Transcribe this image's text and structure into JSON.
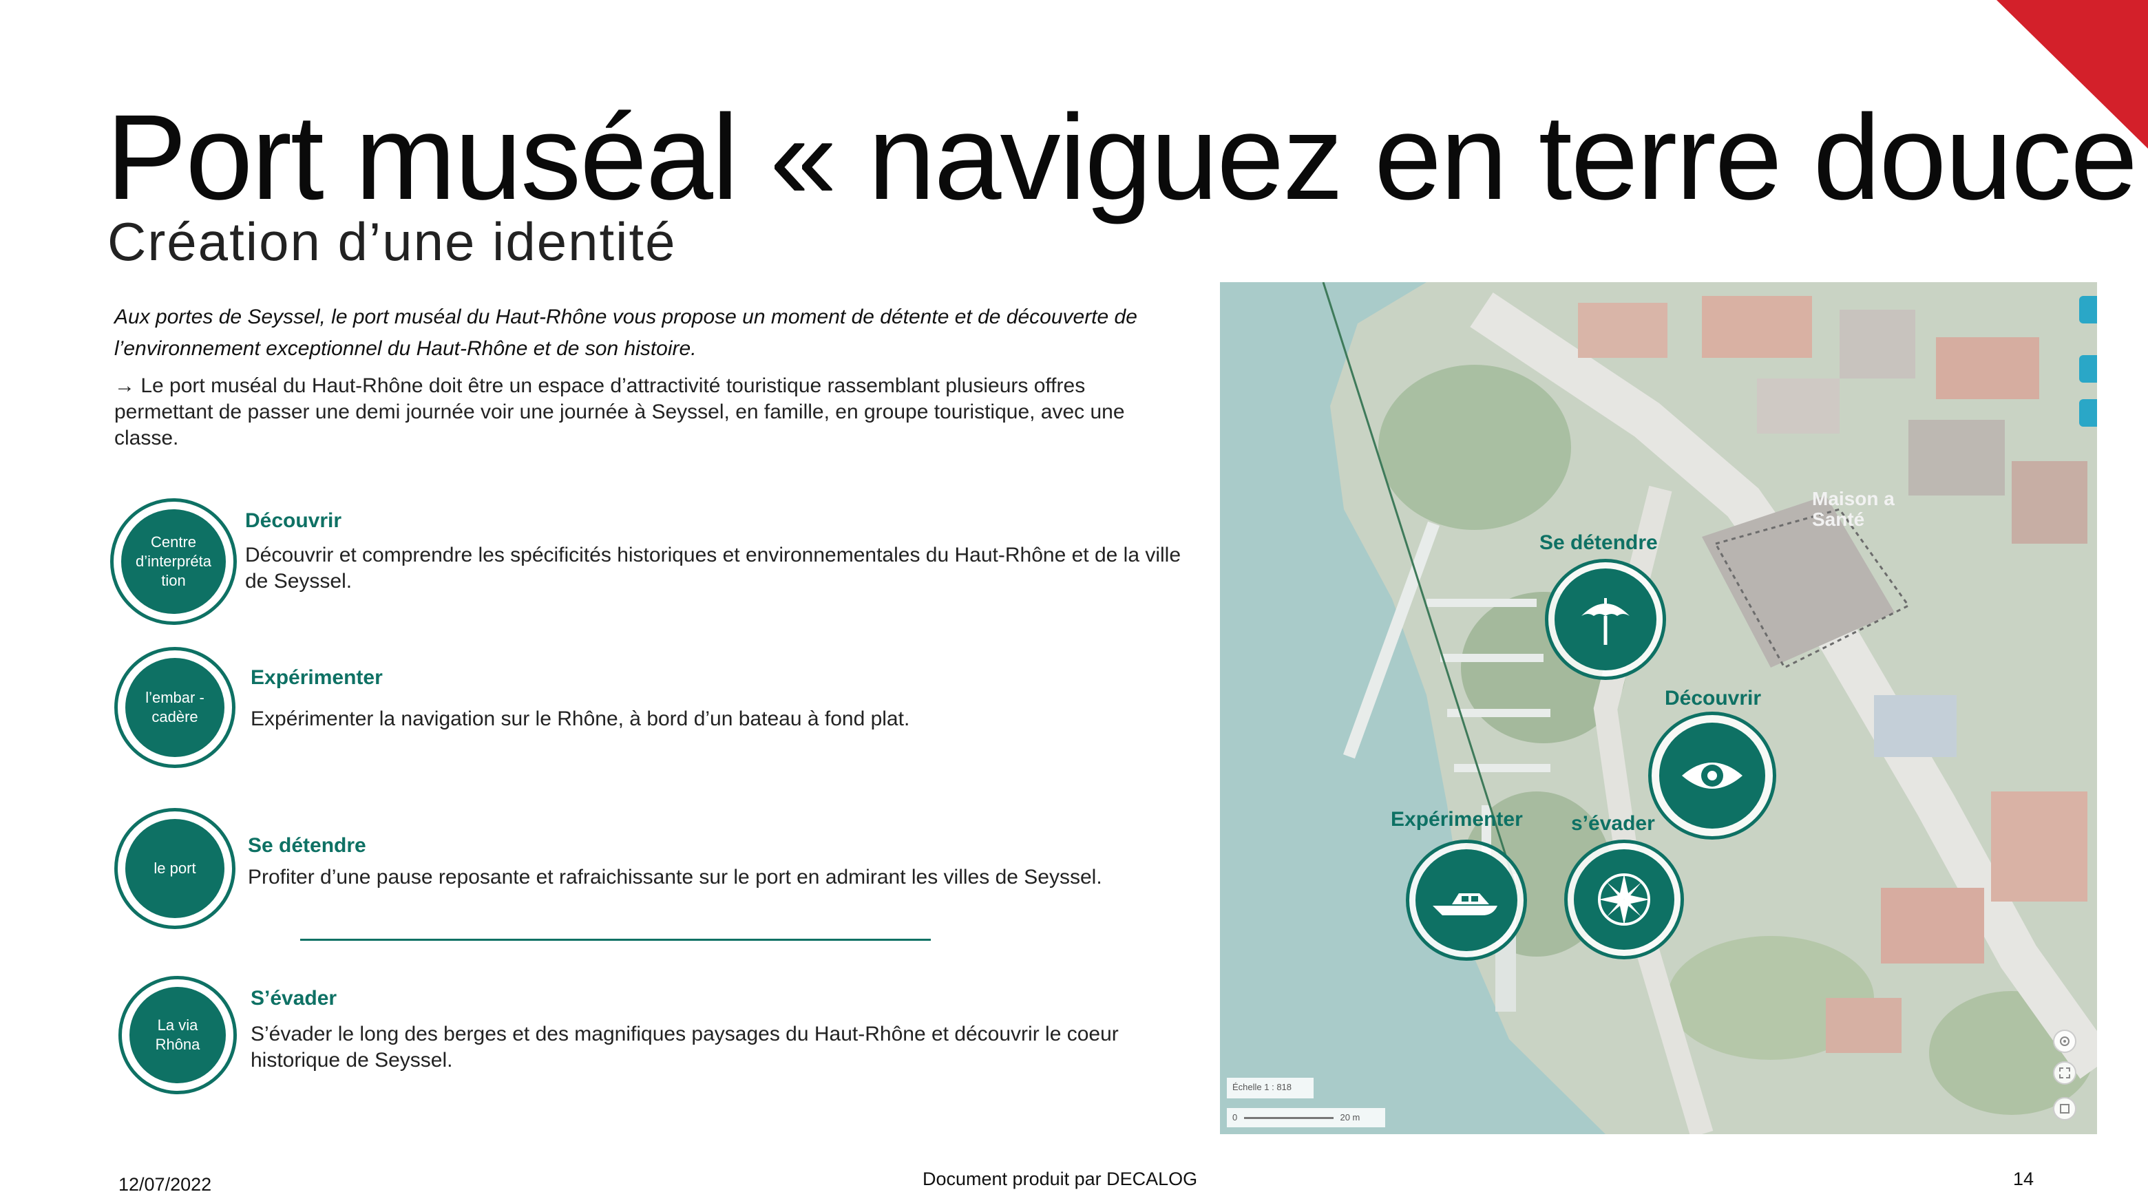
{
  "header": {
    "title": "Port muséal « naviguez en terre douce »",
    "subtitle": "Création d’une identité"
  },
  "intro": "Aux portes de Seyssel, le port muséal du Haut-Rhône vous propose un moment de détente et de découverte de l’environnement exceptionnel du Haut-Rhône et de son histoire.",
  "lead": "→ Le port muséal du Haut-Rhône doit être un espace d’attractivité touristique rassemblant plusieurs offres permettant de passer une demi journée voir une journée à Seyssel, en famille, en groupe touristique, avec une classe.",
  "items": [
    {
      "badge": "Centre d’interpréta tion",
      "title": "Découvrir",
      "text": "Découvrir et comprendre les spécificités historiques et environnementales du Haut-Rhône et de la ville de Seyssel."
    },
    {
      "badge": "l’embar -cadère",
      "title": "Expérimenter",
      "text": "Expérimenter la navigation sur le Rhône, à bord d’un bateau à fond plat."
    },
    {
      "badge": "le port",
      "title": "Se détendre",
      "text": "Profiter d’une pause reposante et rafraichissante sur le port en admirant les villes de Seyssel."
    },
    {
      "badge": "La via Rhôna",
      "title": "S’évader",
      "text": "S’évader le long des berges et des magnifiques paysages du Haut-Rhône et découvrir le coeur historique de Seyssel."
    }
  ],
  "map": {
    "labels": {
      "se_detendre": "Se détendre",
      "decouvrir": "Découvrir",
      "experimenter": "Expérimenter",
      "s_evader": "s’évader",
      "maison": "Maison a Santé"
    },
    "scale_text": "Échelle 1 : 818",
    "scale_bar_start": "0",
    "scale_bar_end": "20 m",
    "icons": [
      "parasol-icon",
      "eye-icon",
      "boat-icon",
      "compass-icon"
    ],
    "accent": "#0e7164",
    "water": "#a9cbc9"
  },
  "footer": {
    "date": "12/07/2022",
    "producer": "Document produit par DECALOG",
    "page": "14"
  },
  "colors": {
    "accent": "#0e7164",
    "corner": "#d3202a"
  }
}
